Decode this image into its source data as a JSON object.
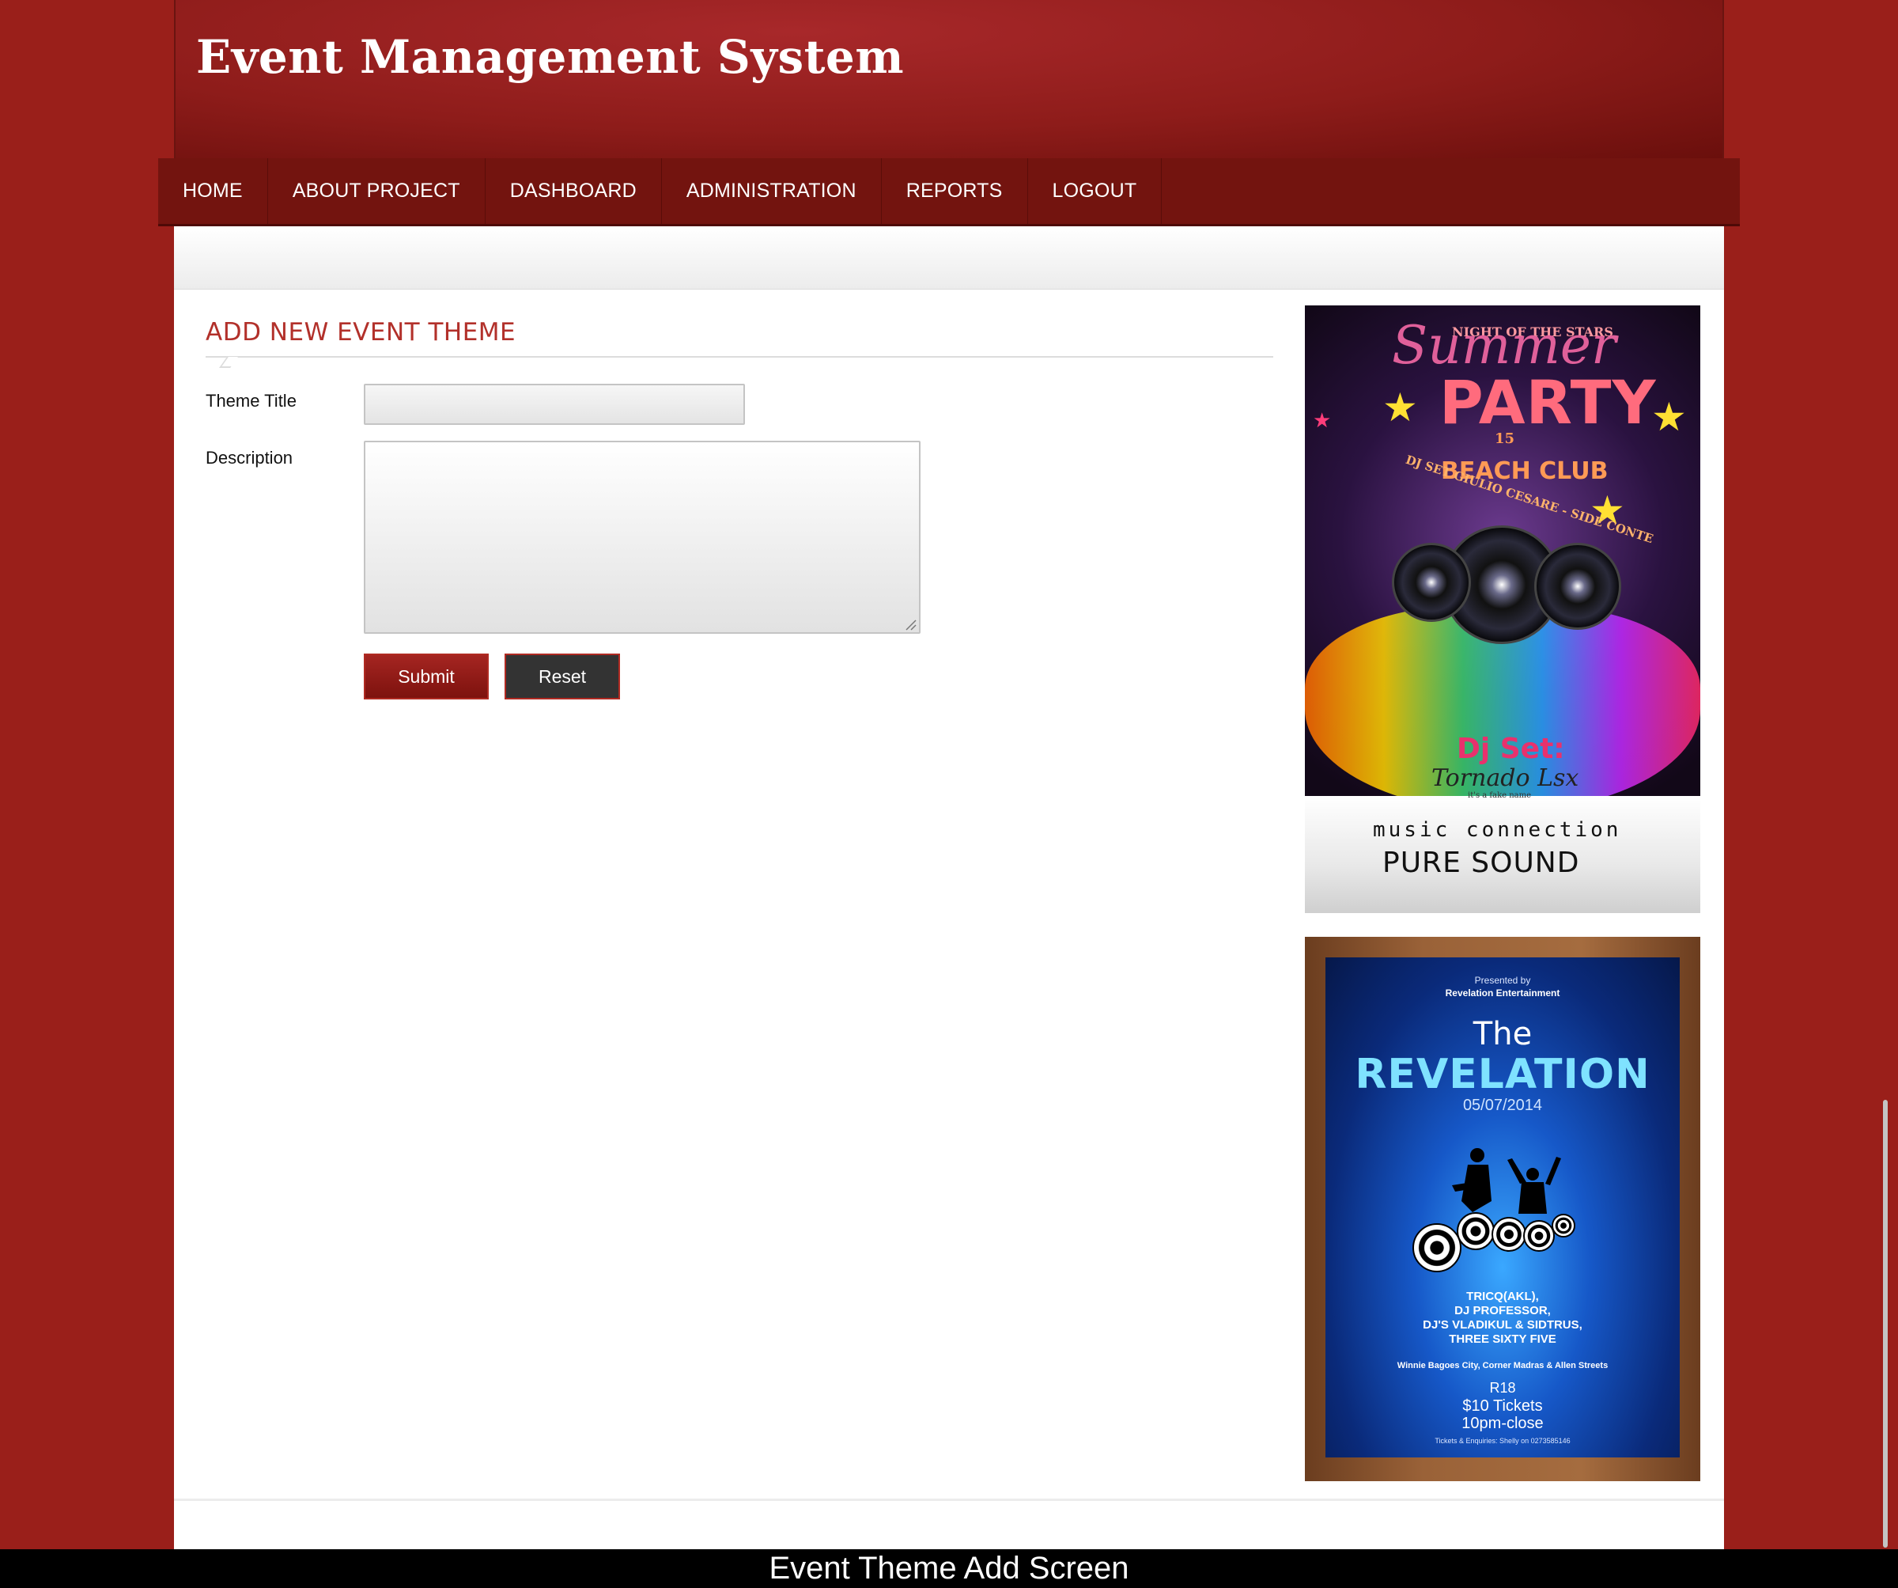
{
  "app": {
    "title": "Event Management System"
  },
  "nav": {
    "items": [
      {
        "label": "HOME"
      },
      {
        "label": "ABOUT PROJECT"
      },
      {
        "label": "DASHBOARD"
      },
      {
        "label": "ADMINISTRATION"
      },
      {
        "label": "REPORTS"
      },
      {
        "label": "LOGOUT"
      }
    ]
  },
  "form": {
    "heading": "ADD NEW EVENT THEME",
    "theme_title_label": "Theme Title",
    "theme_title_value": "",
    "description_label": "Description",
    "description_value": "",
    "submit_label": "Submit",
    "reset_label": "Reset"
  },
  "sidebar": {
    "poster1": {
      "small_line": "NIGHT OF THE STARS",
      "script_word": "Summer",
      "big_word": "PARTY",
      "year": "15",
      "venue": "BEACH CLUB",
      "djs": "DJ SET GIULIO CESARE - SIDE CONTE",
      "dj_set": "Dj Set:",
      "dj_name": "Tornado Lsx",
      "dj_note": "it's a fake name",
      "music": "music connection",
      "pure": "PURE SOUND"
    },
    "poster2": {
      "presented": "Presented by",
      "presenter": "Revelation Entertainment",
      "the": "The",
      "revelation": "REVELATION",
      "date": "05/07/2014",
      "lineup": [
        "TRICQ(AKL),",
        "DJ PROFESSOR,",
        "DJ'S VLADIKUL & SIDTRUS,",
        "THREE SIXTY FIVE"
      ],
      "address": "Winnie Bagoes City, Corner Madras & Allen Streets",
      "r18": "R18",
      "tickets": "$10 Tickets",
      "close": "10pm-close",
      "enquiries": "Tickets & Enquiries: Shelly on 0273585146"
    }
  },
  "caption": "Event Theme Add Screen",
  "colors": {
    "background": "#9a1f1a",
    "nav": "#73140f",
    "accent": "#b2302a",
    "reset_button": "#333333"
  }
}
